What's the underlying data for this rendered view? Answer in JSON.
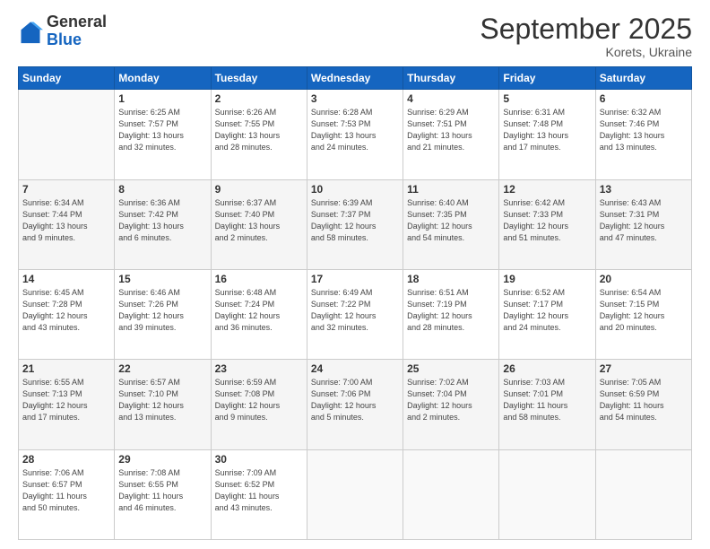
{
  "header": {
    "logo_general": "General",
    "logo_blue": "Blue",
    "month_title": "September 2025",
    "subtitle": "Korets, Ukraine"
  },
  "weekdays": [
    "Sunday",
    "Monday",
    "Tuesday",
    "Wednesday",
    "Thursday",
    "Friday",
    "Saturday"
  ],
  "weeks": [
    [
      {
        "day": "",
        "info": ""
      },
      {
        "day": "1",
        "info": "Sunrise: 6:25 AM\nSunset: 7:57 PM\nDaylight: 13 hours\nand 32 minutes."
      },
      {
        "day": "2",
        "info": "Sunrise: 6:26 AM\nSunset: 7:55 PM\nDaylight: 13 hours\nand 28 minutes."
      },
      {
        "day": "3",
        "info": "Sunrise: 6:28 AM\nSunset: 7:53 PM\nDaylight: 13 hours\nand 24 minutes."
      },
      {
        "day": "4",
        "info": "Sunrise: 6:29 AM\nSunset: 7:51 PM\nDaylight: 13 hours\nand 21 minutes."
      },
      {
        "day": "5",
        "info": "Sunrise: 6:31 AM\nSunset: 7:48 PM\nDaylight: 13 hours\nand 17 minutes."
      },
      {
        "day": "6",
        "info": "Sunrise: 6:32 AM\nSunset: 7:46 PM\nDaylight: 13 hours\nand 13 minutes."
      }
    ],
    [
      {
        "day": "7",
        "info": "Sunrise: 6:34 AM\nSunset: 7:44 PM\nDaylight: 13 hours\nand 9 minutes."
      },
      {
        "day": "8",
        "info": "Sunrise: 6:36 AM\nSunset: 7:42 PM\nDaylight: 13 hours\nand 6 minutes."
      },
      {
        "day": "9",
        "info": "Sunrise: 6:37 AM\nSunset: 7:40 PM\nDaylight: 13 hours\nand 2 minutes."
      },
      {
        "day": "10",
        "info": "Sunrise: 6:39 AM\nSunset: 7:37 PM\nDaylight: 12 hours\nand 58 minutes."
      },
      {
        "day": "11",
        "info": "Sunrise: 6:40 AM\nSunset: 7:35 PM\nDaylight: 12 hours\nand 54 minutes."
      },
      {
        "day": "12",
        "info": "Sunrise: 6:42 AM\nSunset: 7:33 PM\nDaylight: 12 hours\nand 51 minutes."
      },
      {
        "day": "13",
        "info": "Sunrise: 6:43 AM\nSunset: 7:31 PM\nDaylight: 12 hours\nand 47 minutes."
      }
    ],
    [
      {
        "day": "14",
        "info": "Sunrise: 6:45 AM\nSunset: 7:28 PM\nDaylight: 12 hours\nand 43 minutes."
      },
      {
        "day": "15",
        "info": "Sunrise: 6:46 AM\nSunset: 7:26 PM\nDaylight: 12 hours\nand 39 minutes."
      },
      {
        "day": "16",
        "info": "Sunrise: 6:48 AM\nSunset: 7:24 PM\nDaylight: 12 hours\nand 36 minutes."
      },
      {
        "day": "17",
        "info": "Sunrise: 6:49 AM\nSunset: 7:22 PM\nDaylight: 12 hours\nand 32 minutes."
      },
      {
        "day": "18",
        "info": "Sunrise: 6:51 AM\nSunset: 7:19 PM\nDaylight: 12 hours\nand 28 minutes."
      },
      {
        "day": "19",
        "info": "Sunrise: 6:52 AM\nSunset: 7:17 PM\nDaylight: 12 hours\nand 24 minutes."
      },
      {
        "day": "20",
        "info": "Sunrise: 6:54 AM\nSunset: 7:15 PM\nDaylight: 12 hours\nand 20 minutes."
      }
    ],
    [
      {
        "day": "21",
        "info": "Sunrise: 6:55 AM\nSunset: 7:13 PM\nDaylight: 12 hours\nand 17 minutes."
      },
      {
        "day": "22",
        "info": "Sunrise: 6:57 AM\nSunset: 7:10 PM\nDaylight: 12 hours\nand 13 minutes."
      },
      {
        "day": "23",
        "info": "Sunrise: 6:59 AM\nSunset: 7:08 PM\nDaylight: 12 hours\nand 9 minutes."
      },
      {
        "day": "24",
        "info": "Sunrise: 7:00 AM\nSunset: 7:06 PM\nDaylight: 12 hours\nand 5 minutes."
      },
      {
        "day": "25",
        "info": "Sunrise: 7:02 AM\nSunset: 7:04 PM\nDaylight: 12 hours\nand 2 minutes."
      },
      {
        "day": "26",
        "info": "Sunrise: 7:03 AM\nSunset: 7:01 PM\nDaylight: 11 hours\nand 58 minutes."
      },
      {
        "day": "27",
        "info": "Sunrise: 7:05 AM\nSunset: 6:59 PM\nDaylight: 11 hours\nand 54 minutes."
      }
    ],
    [
      {
        "day": "28",
        "info": "Sunrise: 7:06 AM\nSunset: 6:57 PM\nDaylight: 11 hours\nand 50 minutes."
      },
      {
        "day": "29",
        "info": "Sunrise: 7:08 AM\nSunset: 6:55 PM\nDaylight: 11 hours\nand 46 minutes."
      },
      {
        "day": "30",
        "info": "Sunrise: 7:09 AM\nSunset: 6:52 PM\nDaylight: 11 hours\nand 43 minutes."
      },
      {
        "day": "",
        "info": ""
      },
      {
        "day": "",
        "info": ""
      },
      {
        "day": "",
        "info": ""
      },
      {
        "day": "",
        "info": ""
      }
    ]
  ]
}
